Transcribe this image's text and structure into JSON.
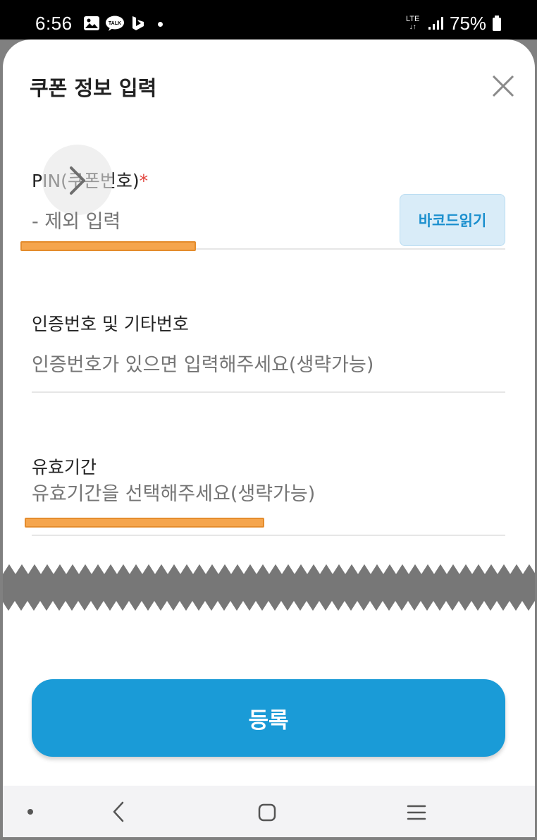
{
  "status_bar": {
    "time": "6:56",
    "network": "LTE",
    "battery": "75%",
    "icons": [
      "gallery-icon",
      "kakaotalk-icon",
      "bing-icon",
      "notification-dot-icon",
      "lte-icon",
      "signal-icon",
      "battery-icon"
    ]
  },
  "dialog": {
    "title": "쿠폰 정보 입력",
    "close_icon": "close-icon"
  },
  "pin_field": {
    "label": "PIN(쿠폰번호)",
    "required_mark": "*",
    "placeholder": "- 제외 입력",
    "barcode_button": "바코드읽기"
  },
  "auth_field": {
    "label": "인증번호 및 기타번호",
    "placeholder": "인증번호가 있으면 입력해주세요(생략가능)"
  },
  "expiry_field": {
    "label": "유효기간",
    "placeholder": "유효기간을 선택해주세요(생략가능)"
  },
  "register_button": "등록",
  "nav_bar": {
    "items": [
      "nav-dot-icon",
      "back-icon",
      "home-icon",
      "recents-icon"
    ]
  },
  "colors": {
    "accent": "#1a9bd7",
    "highlight": "#f5a54d",
    "required": "#e2463f",
    "placeholder": "#a5a5a5"
  }
}
